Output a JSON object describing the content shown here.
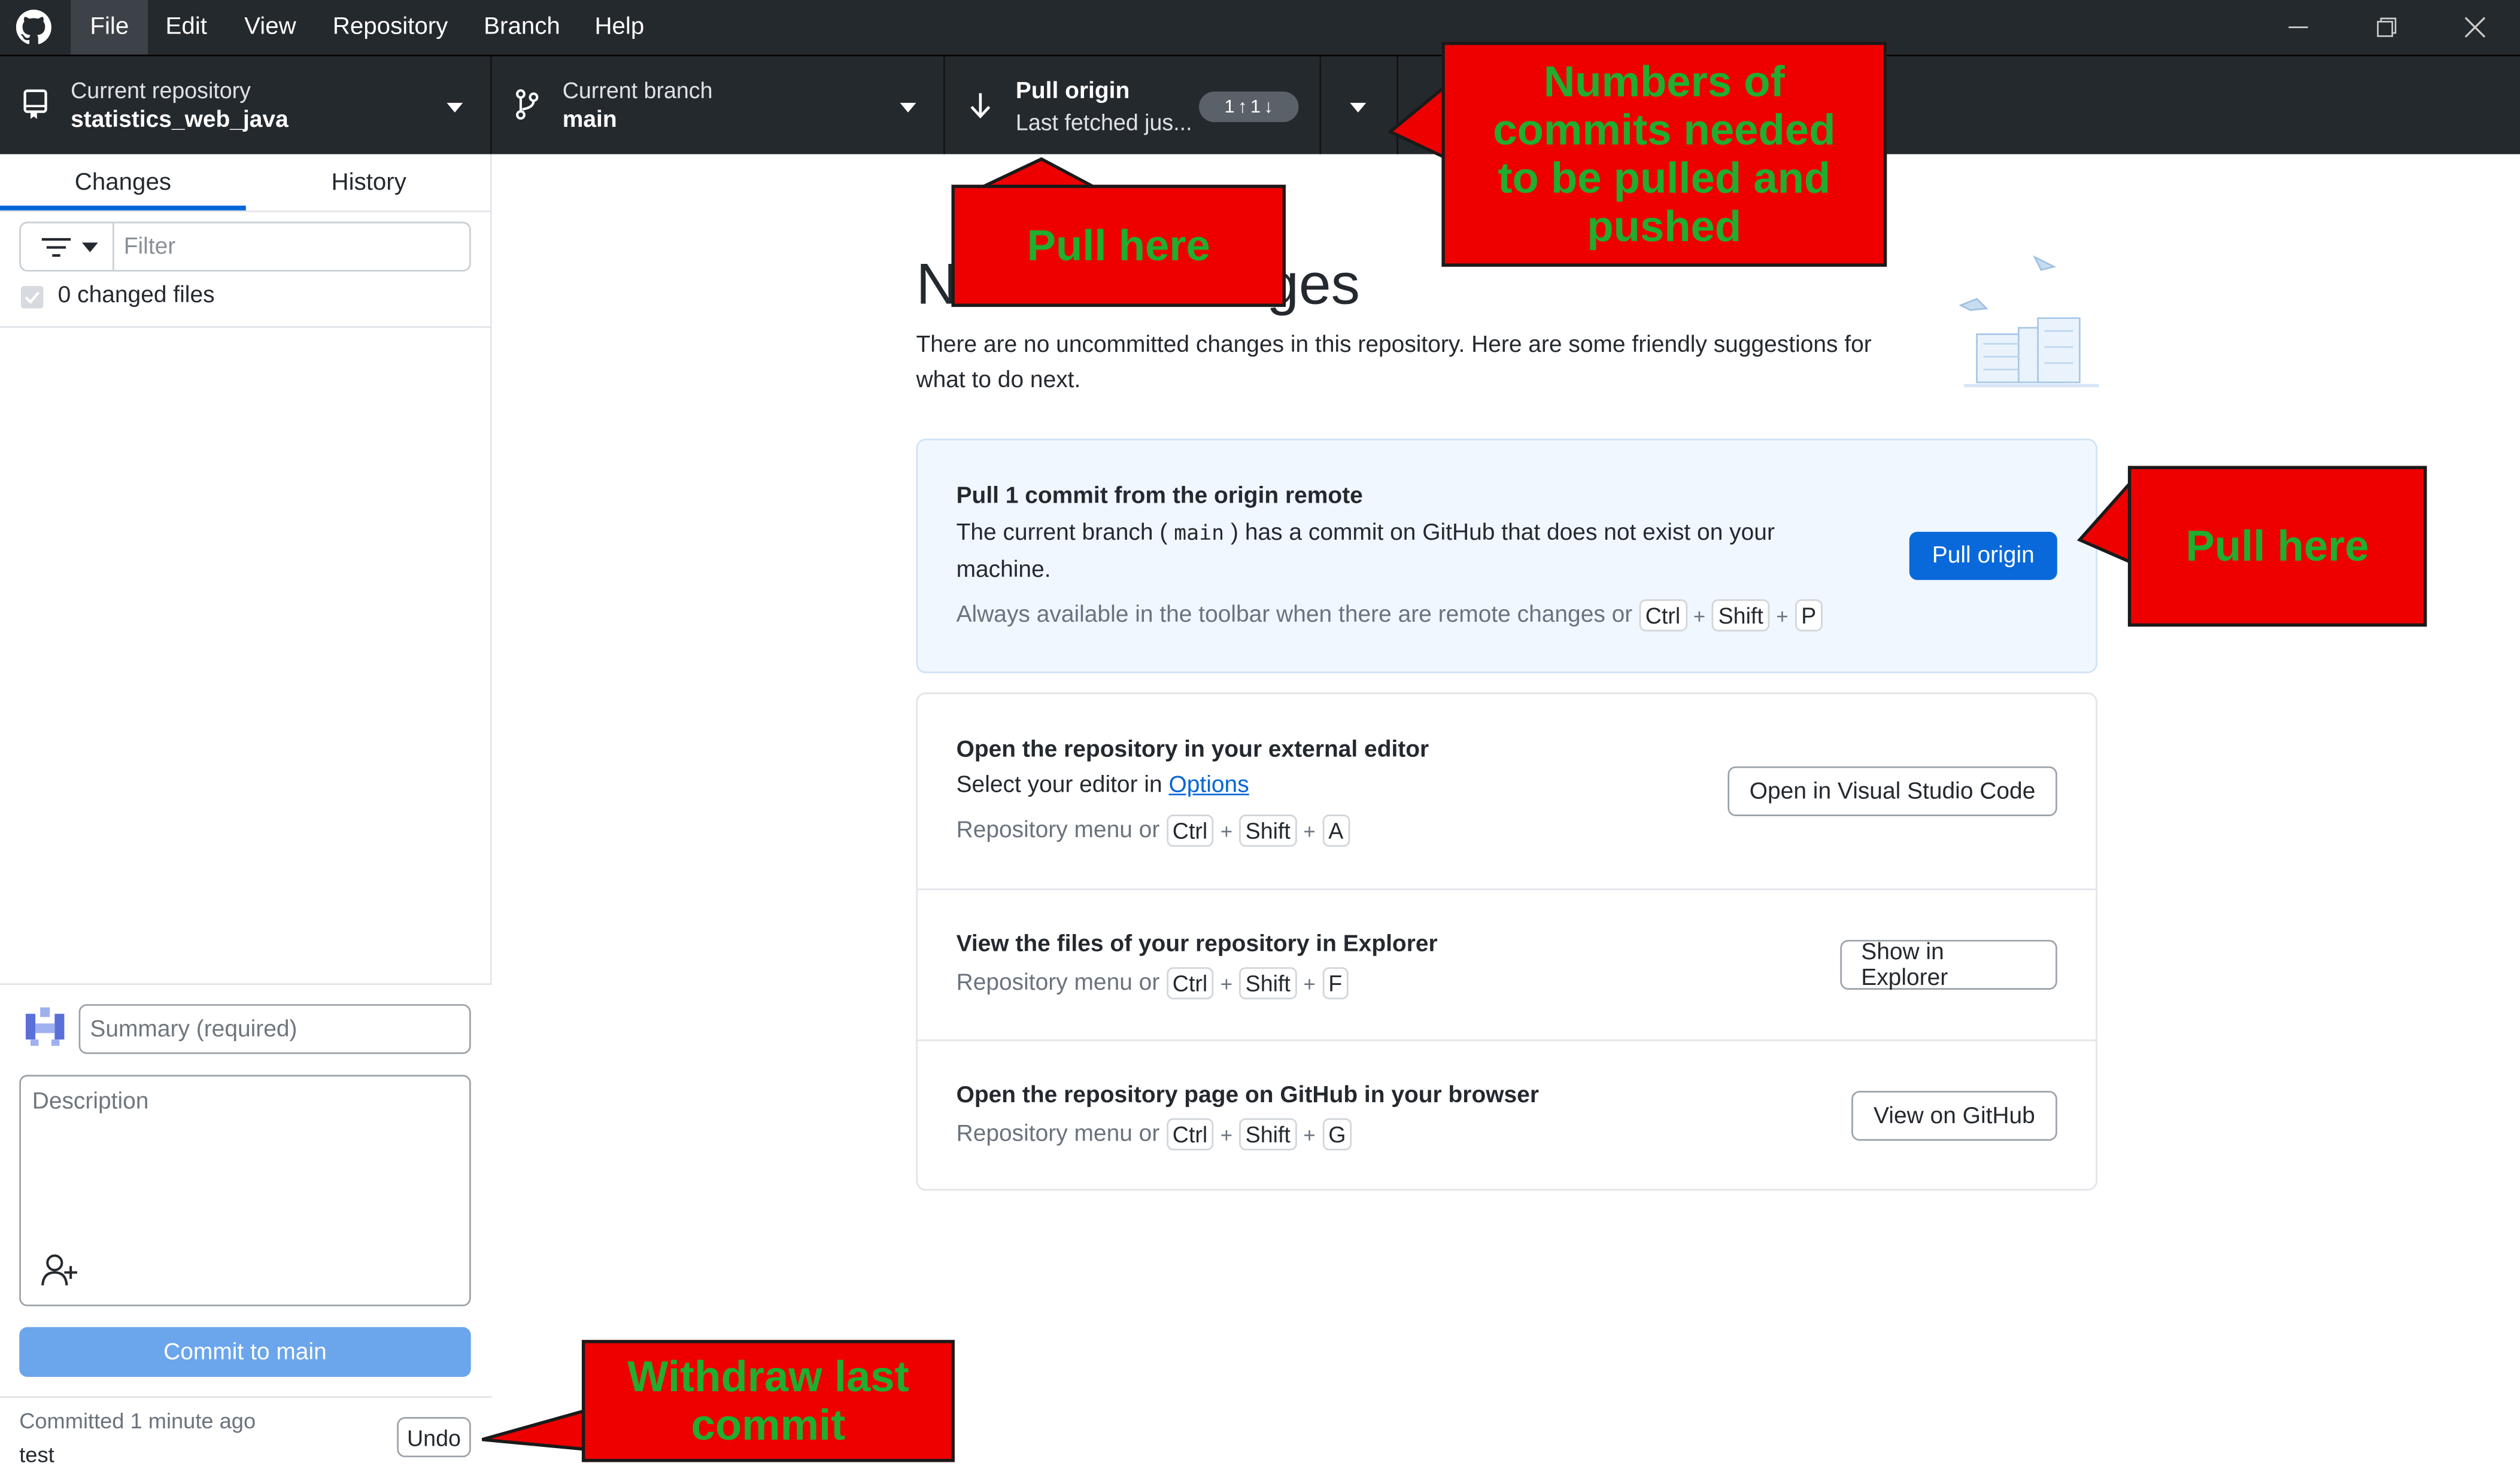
{
  "menubar": {
    "items": [
      "File",
      "Edit",
      "View",
      "Repository",
      "Branch",
      "Help"
    ]
  },
  "toolbar": {
    "repo_label": "Current repository",
    "repo_value": "statistics_web_java",
    "branch_label": "Current branch",
    "branch_value": "main",
    "pull_title": "Pull origin",
    "pull_sub": "Last fetched jus...",
    "ahead_count": "1",
    "behind_count": "1"
  },
  "sidebar": {
    "tabs": [
      "Changes",
      "History"
    ],
    "filter_placeholder": "Filter",
    "changed_files": "0 changed files",
    "summary_placeholder": "Summary (required)",
    "description_placeholder": "Description",
    "commit_button": "Commit to main",
    "committed_ago": "Committed 1 minute ago",
    "commit_message": "test",
    "undo": "Undo"
  },
  "main": {
    "heading": "No local changes",
    "intro": "There are no uncommitted changes in this repository. Here are some friendly suggestions for what to do next.",
    "pull_card": {
      "title": "Pull 1 commit from the origin remote",
      "text_before": "The current branch (",
      "branch": "main",
      "text_after": ") has a commit on GitHub that does not exist on your machine.",
      "hint": "Always available in the toolbar when there are remote changes or",
      "keys": [
        "Ctrl",
        "Shift",
        "P"
      ],
      "button": "Pull origin"
    },
    "editor_card": {
      "title": "Open the repository in your external editor",
      "text": "Select your editor in",
      "link": "Options",
      "hint": "Repository menu or",
      "keys": [
        "Ctrl",
        "Shift",
        "A"
      ],
      "button": "Open in Visual Studio Code"
    },
    "explorer_card": {
      "title": "View the files of your repository in Explorer",
      "hint": "Repository menu or",
      "keys": [
        "Ctrl",
        "Shift",
        "F"
      ],
      "button": "Show in Explorer"
    },
    "github_card": {
      "title": "Open the repository page on GitHub in your browser",
      "hint": "Repository menu or",
      "keys": [
        "Ctrl",
        "Shift",
        "G"
      ],
      "button": "View on GitHub"
    }
  },
  "callouts": {
    "pull_toolbar": "Pull here",
    "numbers": "Numbers of commits needed to be pulled and pushed",
    "pull_button": "Pull here",
    "withdraw": "Withdraw last commit"
  },
  "colors": {
    "chrome": "#24292e",
    "accent": "#0969da",
    "callout_bg": "#ee0000",
    "callout_text": "#1fae2f"
  }
}
